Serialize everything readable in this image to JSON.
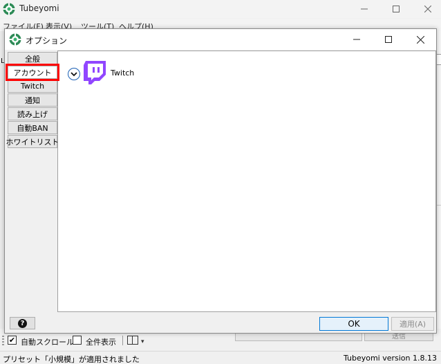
{
  "main_window": {
    "title": "Tubeyomi",
    "menu": [
      "ファイル(F)",
      "表示(V)",
      "ツール(T)",
      "ヘルプ(H)"
    ],
    "side_letter": "L",
    "send_label": "送信",
    "toolbar": {
      "auto_scroll_label": "自動スクロール",
      "auto_scroll_checked": true,
      "show_all_label": "全件表示",
      "show_all_checked": false
    },
    "status": {
      "left": "プリセット「小規模」が適用されました",
      "right": "Tubeyomi version 1.8.13"
    }
  },
  "dialog": {
    "title": "オプション",
    "nav_items": [
      "全般",
      "アカウント",
      "Twitch",
      "通知",
      "読み上げ",
      "自動BAN",
      "ホワイトリスト"
    ],
    "active_nav_index": 1,
    "panel": {
      "service_label": "Twitch"
    },
    "help_label": "?",
    "ok_label": "OK",
    "apply_label": "適用(A)"
  },
  "colors": {
    "twitch_purple": "#9146ff",
    "highlight_red": "#ff0000",
    "accent_blue": "#0078d7"
  }
}
